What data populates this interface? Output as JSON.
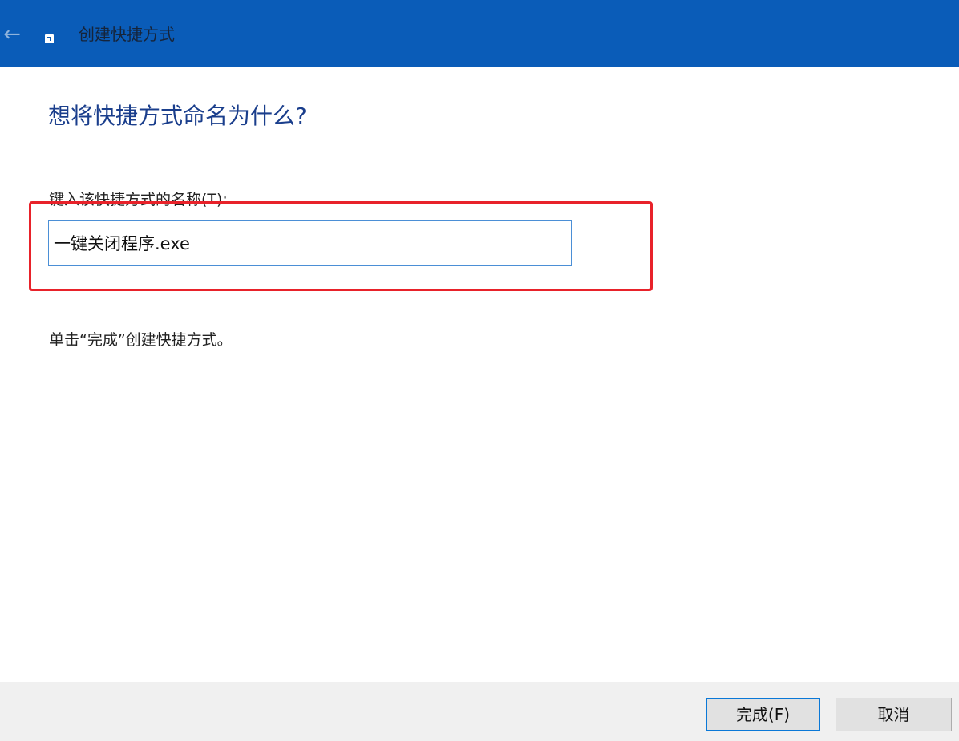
{
  "window": {
    "title": "创建快捷方式",
    "back_glyph": "←"
  },
  "main": {
    "heading": "想将快捷方式命名为什么?",
    "field_label": "键入该快捷方式的名称(T):",
    "name_value": "一键关闭程序.exe",
    "hint": "单击“完成”创建快捷方式。"
  },
  "footer": {
    "finish_label": "完成(F)",
    "cancel_label": "取消"
  },
  "colors": {
    "titlebar": "#0a5cb8",
    "heading": "#1a3e8c",
    "highlight": "#e8222a"
  },
  "icons": {
    "back": "back-arrow-icon",
    "app": "shortcut-icon"
  }
}
